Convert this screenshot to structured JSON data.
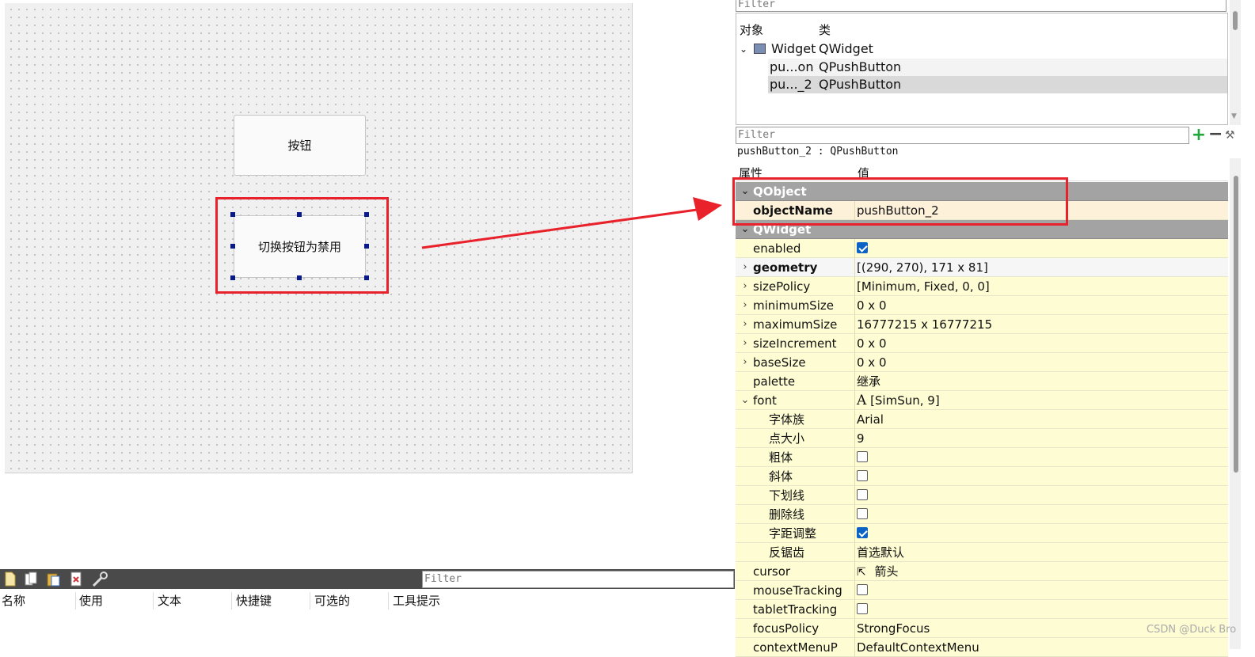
{
  "form": {
    "button1_label": "按钮",
    "button2_label": "切换按钮为禁用"
  },
  "object_inspector": {
    "filter_placeholder": "Filter",
    "col_object": "对象",
    "col_class": "类",
    "rows": [
      {
        "name": "Widget",
        "class": "QWidget"
      },
      {
        "name": "pu...on",
        "class": "QPushButton"
      },
      {
        "name": "pu..._2",
        "class": "QPushButton"
      }
    ]
  },
  "property_editor": {
    "filter_placeholder": "Filter",
    "title": "pushButton_2 : QPushButton",
    "col_property": "属性",
    "col_value": "值",
    "sections": {
      "qobject": "QObject",
      "qwidget": "QWidget"
    },
    "rows": {
      "objectName": {
        "name": "objectName",
        "value": "pushButton_2"
      },
      "enabled": {
        "name": "enabled",
        "checked": true
      },
      "geometry": {
        "name": "geometry",
        "value": "[(290, 270), 171 x 81]"
      },
      "sizePolicy": {
        "name": "sizePolicy",
        "value": "[Minimum, Fixed, 0, 0]"
      },
      "minimumSize": {
        "name": "minimumSize",
        "value": "0 x 0"
      },
      "maximumSize": {
        "name": "maximumSize",
        "value": "16777215 x 16777215"
      },
      "sizeIncrement": {
        "name": "sizeIncrement",
        "value": "0 x 0"
      },
      "baseSize": {
        "name": "baseSize",
        "value": "0 x 0"
      },
      "palette": {
        "name": "palette",
        "value": "继承"
      },
      "font": {
        "name": "font",
        "icon_glyph": "A",
        "value": "[SimSun, 9]"
      },
      "family": {
        "name": "字体族",
        "value": "Arial"
      },
      "pointSize": {
        "name": "点大小",
        "value": "9"
      },
      "bold": {
        "name": "粗体",
        "checked": false
      },
      "italic": {
        "name": "斜体",
        "checked": false
      },
      "underline": {
        "name": "下划线",
        "checked": false
      },
      "strikeout": {
        "name": "删除线",
        "checked": false
      },
      "kerning": {
        "name": "字距调整",
        "checked": true
      },
      "antialiasing": {
        "name": "反锯齿",
        "value": "首选默认"
      },
      "cursor": {
        "name": "cursor",
        "value": "箭头"
      },
      "mouseTracking": {
        "name": "mouseTracking",
        "checked": false
      },
      "tabletTracking": {
        "name": "tabletTracking",
        "checked": false
      },
      "focusPolicy": {
        "name": "focusPolicy",
        "value": "StrongFocus"
      },
      "contextMenuPolicy": {
        "name": "contextMenuP",
        "value": "DefaultContextMenu"
      }
    }
  },
  "action_editor": {
    "filter_placeholder": "Filter",
    "columns": [
      "名称",
      "使用",
      "文本",
      "快捷键",
      "可选的",
      "工具提示"
    ],
    "toolbar_icons": [
      "new-action-icon",
      "copy-action-icon",
      "paste-action-icon",
      "delete-action-icon",
      "settings-wrench-icon"
    ]
  },
  "watermark": "CSDN @Duck Bro",
  "colors": {
    "highlight_red": "#e8212b",
    "section_gray": "#a3a3a3",
    "property_yellow": "#fefcd2",
    "checkbox_blue": "#0d63c5"
  }
}
